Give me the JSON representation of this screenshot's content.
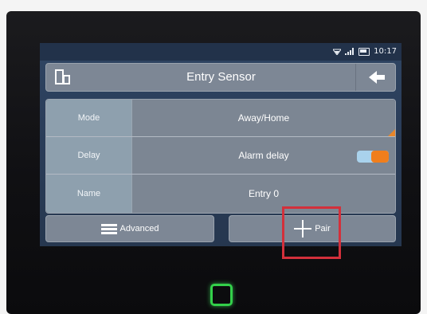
{
  "status_bar": {
    "time": "10:17",
    "icons": [
      "wifi-icon",
      "signal-icon",
      "battery-icon"
    ]
  },
  "header": {
    "title": "Entry Sensor",
    "left_icon": "device-icon",
    "right_icon": "back-arrow-icon"
  },
  "settings": [
    {
      "label": "Mode",
      "value": "Away/Home"
    },
    {
      "label": "Delay",
      "value": "Alarm delay",
      "toggle": "on"
    },
    {
      "label": "Name",
      "value": "Entry 0"
    }
  ],
  "buttons": {
    "advanced_label": "Advanced",
    "pair_label": "Pair"
  },
  "colors": {
    "accent_orange": "#f07e1c",
    "toggle_track": "#a9d2ec",
    "highlight_red": "#d3303b",
    "led_green": "#33d04a"
  }
}
